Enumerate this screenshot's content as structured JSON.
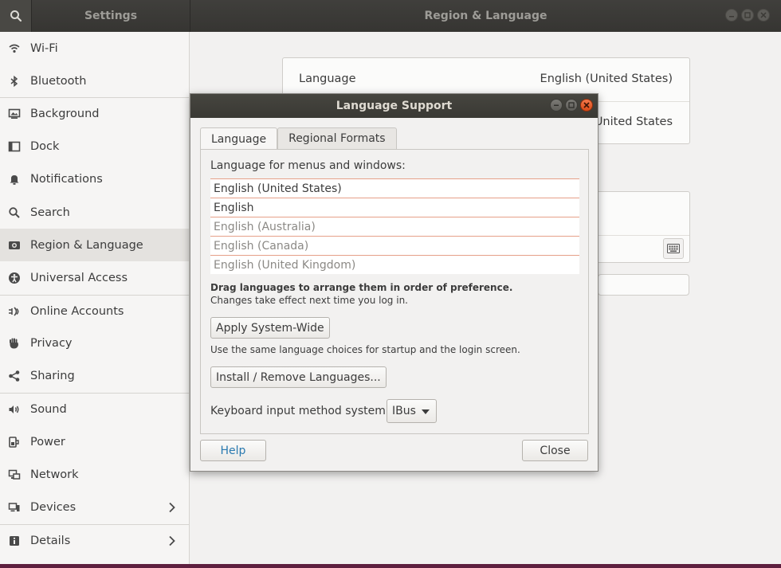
{
  "window": {
    "left_title": "Settings",
    "right_title": "Region & Language"
  },
  "sidebar": {
    "items": [
      {
        "label": "Wi-Fi",
        "icon": "wifi-icon"
      },
      {
        "label": "Bluetooth",
        "icon": "bluetooth-icon"
      },
      {
        "label": "Background",
        "icon": "background-icon"
      },
      {
        "label": "Dock",
        "icon": "dock-icon"
      },
      {
        "label": "Notifications",
        "icon": "bell-icon"
      },
      {
        "label": "Search",
        "icon": "search-icon"
      },
      {
        "label": "Region & Language",
        "icon": "region-icon"
      },
      {
        "label": "Universal Access",
        "icon": "accessibility-icon"
      },
      {
        "label": "Online Accounts",
        "icon": "online-accounts-icon"
      },
      {
        "label": "Privacy",
        "icon": "hand-icon"
      },
      {
        "label": "Sharing",
        "icon": "share-icon"
      },
      {
        "label": "Sound",
        "icon": "speaker-icon"
      },
      {
        "label": "Power",
        "icon": "power-icon"
      },
      {
        "label": "Network",
        "icon": "network-icon"
      },
      {
        "label": "Devices",
        "icon": "devices-icon"
      },
      {
        "label": "Details",
        "icon": "info-icon"
      }
    ],
    "active_index": 6
  },
  "main": {
    "language_label": "Language",
    "language_value": "English (United States)",
    "formats_value": "United States"
  },
  "dialog": {
    "title": "Language Support",
    "tabs": [
      "Language",
      "Regional Formats"
    ],
    "list_label": "Language for menus and windows:",
    "languages": [
      {
        "name": "English (United States)",
        "dim": false
      },
      {
        "name": "English",
        "dim": false
      },
      {
        "name": "English (Australia)",
        "dim": true
      },
      {
        "name": "English (Canada)",
        "dim": true
      },
      {
        "name": "English (United Kingdom)",
        "dim": true
      }
    ],
    "drag_hint": "Drag languages to arrange them in order of preference.",
    "effect_hint": "Changes take effect next time you log in.",
    "apply_button": "Apply System-Wide",
    "apply_hint": "Use the same language choices for startup and the login screen.",
    "install_button": "Install / Remove Languages...",
    "input_method_label": "Keyboard input method system:",
    "input_method_value": "IBus",
    "help_button": "Help",
    "close_button": "Close"
  },
  "colors": {
    "titlebar": "#3b3a36",
    "accent_link": "#2a7ab0",
    "close_button": "#e3561e",
    "list_separator": "#e6a089"
  }
}
